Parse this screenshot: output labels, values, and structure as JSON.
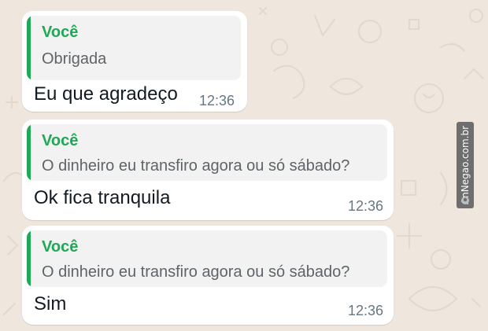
{
  "chat": {
    "messages": [
      {
        "quote_author": "Você",
        "quote_text": "Obrigada",
        "text": "Eu que agradeço",
        "time": "12:36"
      },
      {
        "quote_author": "Você",
        "quote_text": "O dinheiro eu transfiro agora ou só sábado?",
        "text": "Ok fica tranquila",
        "time": "12:36"
      },
      {
        "quote_author": "Você",
        "quote_text": "O dinheiro eu transfiro agora ou só sábado?",
        "text": "Sim",
        "time": "12:36"
      }
    ]
  },
  "watermark": {
    "text": "AnNegao.com.br"
  },
  "colors": {
    "quote_accent": "#1FA855",
    "bubble": "#FFFFFF",
    "quote_background": "#F1F2F1",
    "wallpaper": "#EFE7DE"
  }
}
